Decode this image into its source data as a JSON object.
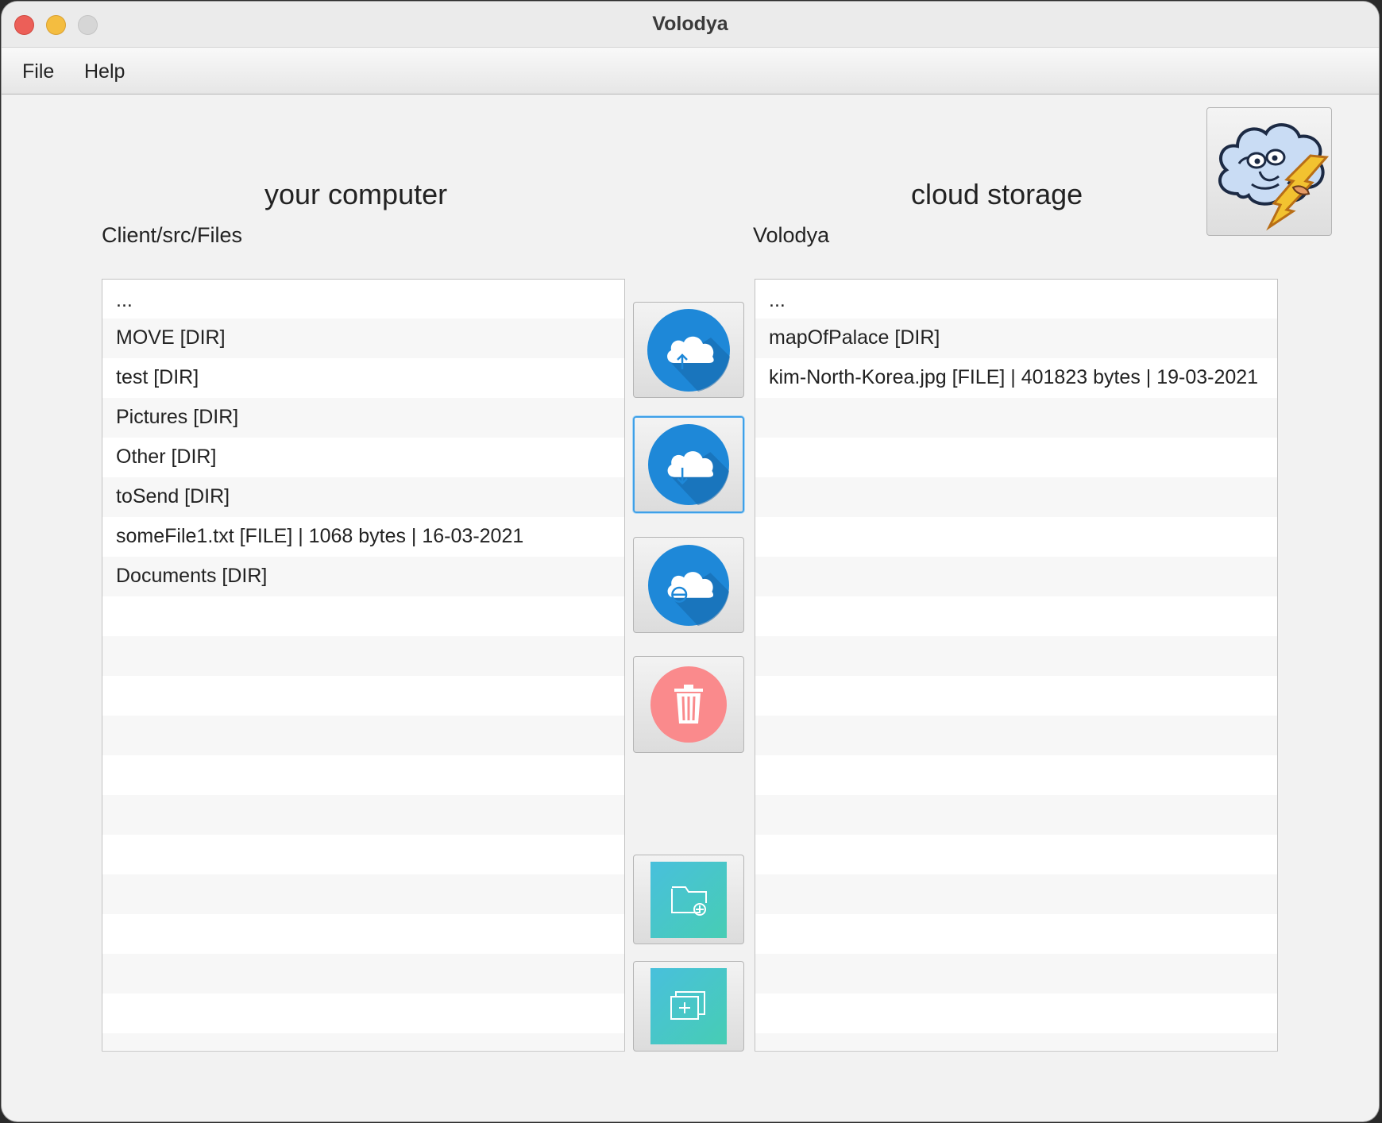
{
  "window": {
    "title": "Volodya"
  },
  "menu": {
    "file": "File",
    "help": "Help"
  },
  "local": {
    "heading": "your computer",
    "path": "Client/src/Files",
    "items": [
      "...",
      "MOVE [DIR]",
      "test [DIR]",
      "Pictures [DIR]",
      "Other [DIR]",
      "toSend [DIR]",
      "someFile1.txt [FILE] | 1068 bytes | 16-03-2021",
      "Documents [DIR]"
    ]
  },
  "cloud": {
    "heading": "cloud storage",
    "path": "Volodya",
    "items": [
      "...",
      "mapOfPalace [DIR]",
      "kim-North-Korea.jpg [FILE] | 401823 bytes | 19-03-2021"
    ]
  },
  "actions": {
    "upload": "cloud-upload-icon",
    "download": "cloud-download-icon",
    "rename": "cloud-rename-icon",
    "delete": "trash-icon",
    "new_folder": "folder-plus-icon",
    "new_file": "copy-plus-icon"
  },
  "colors": {
    "cloud_blue": "#1e88d8",
    "delete_red": "#fa8a8c",
    "teal_start": "#48c0dc",
    "teal_end": "#47cdb4",
    "focus_border": "#3ea0e8"
  }
}
